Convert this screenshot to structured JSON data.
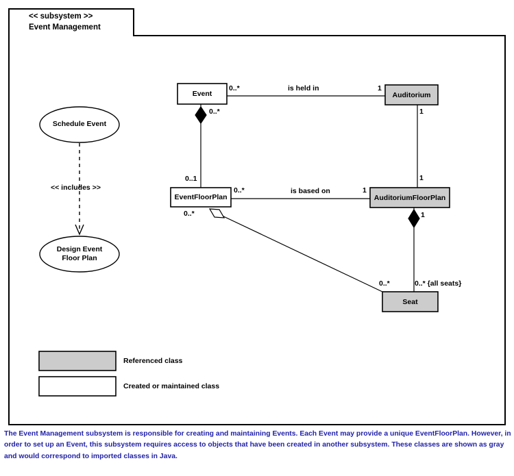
{
  "diagram": {
    "type": "uml-subsystem-class-diagram",
    "subsystem": {
      "stereotype": "<< subsystem >>",
      "name": "Event Management"
    },
    "use_cases": [
      {
        "id": "schedule-event",
        "label_line1": "Schedule Event",
        "label_line2": ""
      },
      {
        "id": "design-event-floor-plan",
        "label_line1": "Design Event",
        "label_line2": "Floor Plan"
      }
    ],
    "include_relationship": {
      "label": "<< includes >>",
      "from": "schedule-event",
      "to": "design-event-floor-plan",
      "style": "dashed-arrow"
    },
    "classes": [
      {
        "id": "event",
        "name": "Event",
        "fill": "#ffffff",
        "kind": "created-or-maintained"
      },
      {
        "id": "auditorium",
        "name": "Auditorium",
        "fill": "#cccccc",
        "kind": "referenced"
      },
      {
        "id": "event-floor-plan",
        "name": "EventFloorPlan",
        "fill": "#ffffff",
        "kind": "created-or-maintained"
      },
      {
        "id": "auditorium-floor-plan",
        "name": "AuditoriumFloorPlan",
        "fill": "#cccccc",
        "kind": "referenced"
      },
      {
        "id": "seat",
        "name": "Seat",
        "fill": "#cccccc",
        "kind": "referenced"
      }
    ],
    "associations": [
      {
        "id": "event-held-in-auditorium",
        "name": "is held in",
        "source": "event",
        "target": "auditorium",
        "source_multiplicity": "0..*",
        "target_multiplicity": "1"
      },
      {
        "id": "event-composes-event-floor-plan",
        "name": "",
        "source": "event",
        "target": "event-floor-plan",
        "source_multiplicity": "0..*",
        "target_multiplicity": "0..1",
        "decoration": "filled-diamond"
      },
      {
        "id": "efp-based-on-afp",
        "name": "is based on",
        "source": "event-floor-plan",
        "target": "auditorium-floor-plan",
        "source_multiplicity": "0..*",
        "target_multiplicity": "1"
      },
      {
        "id": "auditorium-composes-afp",
        "name": "",
        "source": "auditorium",
        "target": "auditorium-floor-plan",
        "source_multiplicity": "1",
        "target_multiplicity": "1"
      },
      {
        "id": "afp-composes-seat",
        "name": "",
        "source": "auditorium-floor-plan",
        "target": "seat",
        "source_multiplicity": "1",
        "target_multiplicity": "0..* {all seats}",
        "decoration": "filled-diamond"
      },
      {
        "id": "efp-aggregates-seat",
        "name": "",
        "source": "event-floor-plan",
        "target": "seat",
        "source_multiplicity": "0..*",
        "target_multiplicity": "0..*",
        "decoration": "hollow-diamond"
      }
    ],
    "multiplicity_labels": {
      "event_to_auditorium_source": "0..*",
      "event_to_auditorium_target": "1",
      "event_to_efp_source": "0..*",
      "event_to_efp_target": "0..1",
      "auditorium_to_afp_source": "1",
      "auditorium_to_afp_target": "1",
      "efp_to_afp_source": "0..*",
      "efp_to_afp_target": "1",
      "afp_to_seat_source": "1",
      "afp_to_seat_target": "0..* {all seats}",
      "efp_to_seat_source": "0..*",
      "efp_to_seat_target": "0..*"
    },
    "association_names": {
      "is_held_in": "is held in",
      "is_based_on": "is based on"
    }
  },
  "legend": {
    "items": [
      {
        "label": "Referenced class",
        "fill": "#cccccc"
      },
      {
        "label": "Created or maintained class",
        "fill": "#ffffff"
      }
    ]
  },
  "caption": {
    "text": "The Event Management subsystem is responsible for creating and maintaining Events.  Each Event may provide a unique EventFloorPlan.  However, in order to set up an Event, this subsystem requires access to objects that have been created in another subsystem.  These classes are shown as gray and would correspond to imported classes in Java.",
    "color": "#2222aa"
  },
  "colors": {
    "referenced_fill": "#cccccc",
    "created_fill": "#ffffff",
    "stroke": "#000000",
    "caption": "#2222aa"
  }
}
